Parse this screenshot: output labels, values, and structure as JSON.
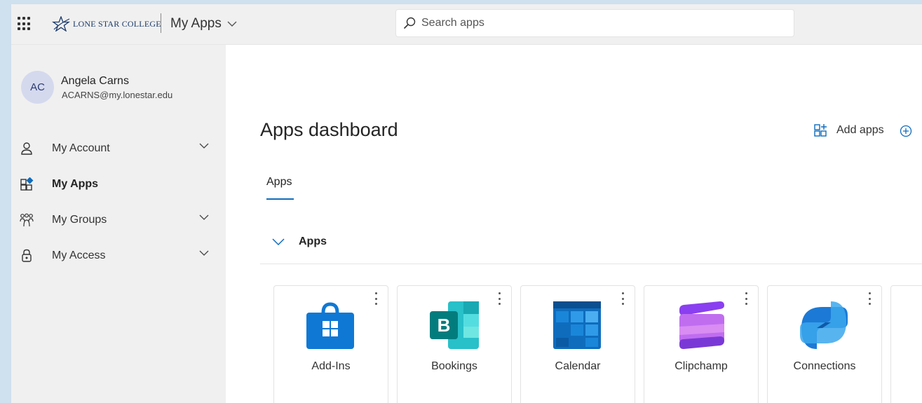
{
  "header": {
    "org_name": "LONE STAR COLLEGE",
    "app_title": "My Apps"
  },
  "search": {
    "placeholder": "Search apps"
  },
  "user": {
    "initials": "AC",
    "name": "Angela Carns",
    "email": "ACARNS@my.lonestar.edu"
  },
  "nav": {
    "items": [
      {
        "label": "My Account",
        "icon": "person-icon",
        "expandable": true
      },
      {
        "label": "My Apps",
        "icon": "apps-icon",
        "active": true
      },
      {
        "label": "My Groups",
        "icon": "groups-icon",
        "expandable": true
      },
      {
        "label": "My Access",
        "icon": "lock-icon",
        "expandable": true
      }
    ]
  },
  "main": {
    "title": "Apps dashboard",
    "add_apps_label": "Add apps",
    "tabs": [
      {
        "label": "Apps",
        "active": true
      }
    ],
    "section_title": "Apps"
  },
  "apps": [
    {
      "name": "Add-Ins",
      "icon": "store-icon",
      "color": "#0f78d4"
    },
    {
      "name": "Bookings",
      "icon": "bookings-icon",
      "color": "#037c7e"
    },
    {
      "name": "Calendar",
      "icon": "calendar-icon",
      "color": "#0f6cbd"
    },
    {
      "name": "Clipchamp",
      "icon": "clipchamp-icon",
      "color": "#a05ae0"
    },
    {
      "name": "Connections",
      "icon": "connections-icon",
      "color": "#1878d8"
    }
  ],
  "colors": {
    "accent": "#0f6cbd",
    "sidebar_bg": "#f0f0f0",
    "page_backdrop": "#cfe0ef"
  }
}
